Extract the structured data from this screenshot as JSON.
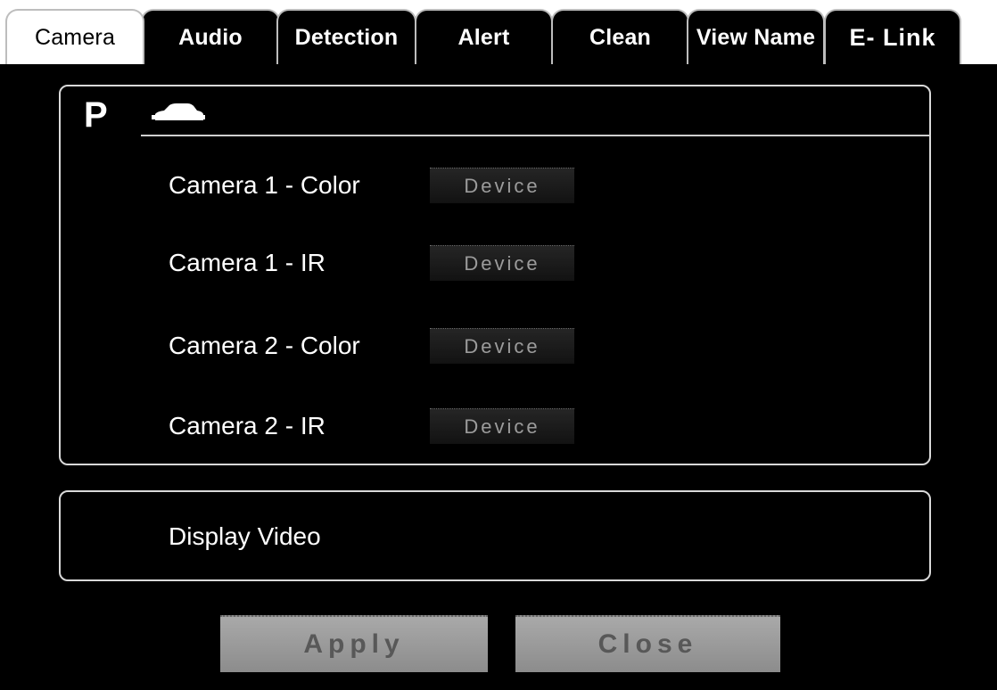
{
  "tabs": [
    {
      "label": "Camera",
      "active": true
    },
    {
      "label": "Audio"
    },
    {
      "label": "Detection"
    },
    {
      "label": "Alert"
    },
    {
      "label": "Clean"
    },
    {
      "label": "View Name"
    },
    {
      "label": "E- Link"
    }
  ],
  "section": {
    "badge": "P",
    "icon": "car-icon"
  },
  "cameras": [
    {
      "label": "Camera 1 - Color",
      "button": "Device"
    },
    {
      "label": "Camera 1 - IR",
      "button": "Device"
    },
    {
      "label": "Camera 2 - Color",
      "button": "Device"
    },
    {
      "label": "Camera 2 - IR",
      "button": "Device"
    }
  ],
  "video": {
    "label": "Display Video"
  },
  "footer": {
    "apply_label": "Apply",
    "close_label": "Close"
  },
  "colors": {
    "background": "#000000",
    "tab_active": "#ffffff",
    "button_gray": "#9a9a9a"
  }
}
